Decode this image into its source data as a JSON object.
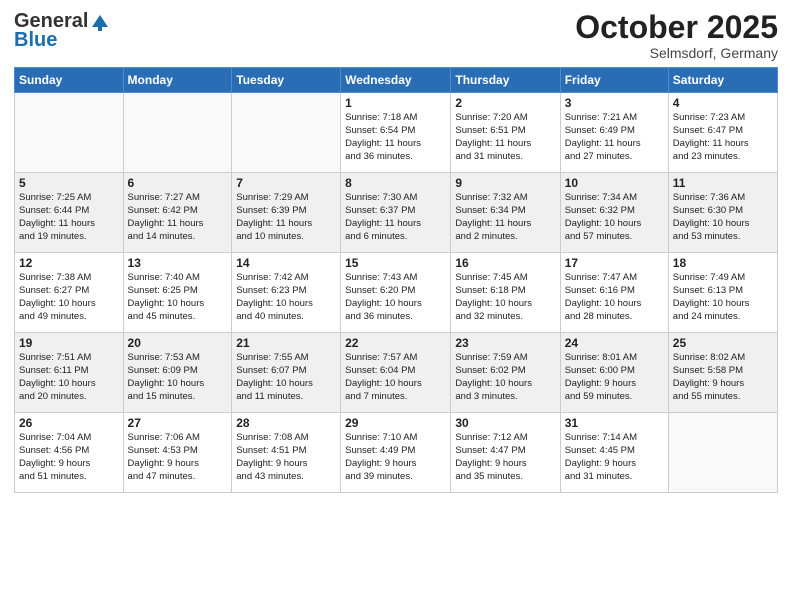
{
  "header": {
    "logo_general": "General",
    "logo_blue": "Blue",
    "month": "October 2025",
    "location": "Selmsdorf, Germany"
  },
  "weekdays": [
    "Sunday",
    "Monday",
    "Tuesday",
    "Wednesday",
    "Thursday",
    "Friday",
    "Saturday"
  ],
  "weeks": [
    [
      {
        "day": "",
        "info": ""
      },
      {
        "day": "",
        "info": ""
      },
      {
        "day": "",
        "info": ""
      },
      {
        "day": "1",
        "info": "Sunrise: 7:18 AM\nSunset: 6:54 PM\nDaylight: 11 hours\nand 36 minutes."
      },
      {
        "day": "2",
        "info": "Sunrise: 7:20 AM\nSunset: 6:51 PM\nDaylight: 11 hours\nand 31 minutes."
      },
      {
        "day": "3",
        "info": "Sunrise: 7:21 AM\nSunset: 6:49 PM\nDaylight: 11 hours\nand 27 minutes."
      },
      {
        "day": "4",
        "info": "Sunrise: 7:23 AM\nSunset: 6:47 PM\nDaylight: 11 hours\nand 23 minutes."
      }
    ],
    [
      {
        "day": "5",
        "info": "Sunrise: 7:25 AM\nSunset: 6:44 PM\nDaylight: 11 hours\nand 19 minutes."
      },
      {
        "day": "6",
        "info": "Sunrise: 7:27 AM\nSunset: 6:42 PM\nDaylight: 11 hours\nand 14 minutes."
      },
      {
        "day": "7",
        "info": "Sunrise: 7:29 AM\nSunset: 6:39 PM\nDaylight: 11 hours\nand 10 minutes."
      },
      {
        "day": "8",
        "info": "Sunrise: 7:30 AM\nSunset: 6:37 PM\nDaylight: 11 hours\nand 6 minutes."
      },
      {
        "day": "9",
        "info": "Sunrise: 7:32 AM\nSunset: 6:34 PM\nDaylight: 11 hours\nand 2 minutes."
      },
      {
        "day": "10",
        "info": "Sunrise: 7:34 AM\nSunset: 6:32 PM\nDaylight: 10 hours\nand 57 minutes."
      },
      {
        "day": "11",
        "info": "Sunrise: 7:36 AM\nSunset: 6:30 PM\nDaylight: 10 hours\nand 53 minutes."
      }
    ],
    [
      {
        "day": "12",
        "info": "Sunrise: 7:38 AM\nSunset: 6:27 PM\nDaylight: 10 hours\nand 49 minutes."
      },
      {
        "day": "13",
        "info": "Sunrise: 7:40 AM\nSunset: 6:25 PM\nDaylight: 10 hours\nand 45 minutes."
      },
      {
        "day": "14",
        "info": "Sunrise: 7:42 AM\nSunset: 6:23 PM\nDaylight: 10 hours\nand 40 minutes."
      },
      {
        "day": "15",
        "info": "Sunrise: 7:43 AM\nSunset: 6:20 PM\nDaylight: 10 hours\nand 36 minutes."
      },
      {
        "day": "16",
        "info": "Sunrise: 7:45 AM\nSunset: 6:18 PM\nDaylight: 10 hours\nand 32 minutes."
      },
      {
        "day": "17",
        "info": "Sunrise: 7:47 AM\nSunset: 6:16 PM\nDaylight: 10 hours\nand 28 minutes."
      },
      {
        "day": "18",
        "info": "Sunrise: 7:49 AM\nSunset: 6:13 PM\nDaylight: 10 hours\nand 24 minutes."
      }
    ],
    [
      {
        "day": "19",
        "info": "Sunrise: 7:51 AM\nSunset: 6:11 PM\nDaylight: 10 hours\nand 20 minutes."
      },
      {
        "day": "20",
        "info": "Sunrise: 7:53 AM\nSunset: 6:09 PM\nDaylight: 10 hours\nand 15 minutes."
      },
      {
        "day": "21",
        "info": "Sunrise: 7:55 AM\nSunset: 6:07 PM\nDaylight: 10 hours\nand 11 minutes."
      },
      {
        "day": "22",
        "info": "Sunrise: 7:57 AM\nSunset: 6:04 PM\nDaylight: 10 hours\nand 7 minutes."
      },
      {
        "day": "23",
        "info": "Sunrise: 7:59 AM\nSunset: 6:02 PM\nDaylight: 10 hours\nand 3 minutes."
      },
      {
        "day": "24",
        "info": "Sunrise: 8:01 AM\nSunset: 6:00 PM\nDaylight: 9 hours\nand 59 minutes."
      },
      {
        "day": "25",
        "info": "Sunrise: 8:02 AM\nSunset: 5:58 PM\nDaylight: 9 hours\nand 55 minutes."
      }
    ],
    [
      {
        "day": "26",
        "info": "Sunrise: 7:04 AM\nSunset: 4:56 PM\nDaylight: 9 hours\nand 51 minutes."
      },
      {
        "day": "27",
        "info": "Sunrise: 7:06 AM\nSunset: 4:53 PM\nDaylight: 9 hours\nand 47 minutes."
      },
      {
        "day": "28",
        "info": "Sunrise: 7:08 AM\nSunset: 4:51 PM\nDaylight: 9 hours\nand 43 minutes."
      },
      {
        "day": "29",
        "info": "Sunrise: 7:10 AM\nSunset: 4:49 PM\nDaylight: 9 hours\nand 39 minutes."
      },
      {
        "day": "30",
        "info": "Sunrise: 7:12 AM\nSunset: 4:47 PM\nDaylight: 9 hours\nand 35 minutes."
      },
      {
        "day": "31",
        "info": "Sunrise: 7:14 AM\nSunset: 4:45 PM\nDaylight: 9 hours\nand 31 minutes."
      },
      {
        "day": "",
        "info": ""
      }
    ]
  ]
}
